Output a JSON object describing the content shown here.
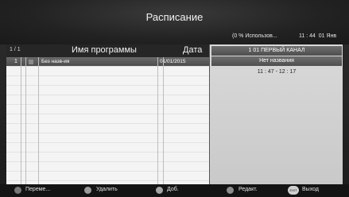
{
  "header": {
    "title": "Расписание",
    "status": "(0 % Использов...",
    "time": "11 : 44",
    "date": "01 Янв"
  },
  "list": {
    "page": "1 / 1",
    "col_name": "Имя программы",
    "col_date": "Дата",
    "rows": [
      {
        "num": "1",
        "name": "Без назв-ия",
        "date": "01/01/2015"
      }
    ]
  },
  "info": {
    "channel": "1 01 ПЕРВЫЙ КАНАЛ",
    "program": "Нет названия",
    "time_range": "11 : 47 - 12 : 17"
  },
  "footer": {
    "move": "Переме...",
    "delete": "Удалить",
    "add": "Доб.",
    "edit": "Редакт.",
    "exit_icon": "EXIT",
    "exit": "Выход"
  },
  "colors": {
    "red": "#c0392b",
    "green": "#4aa04a",
    "yellow": "#d4b000",
    "blue": "#2f6fc0"
  }
}
